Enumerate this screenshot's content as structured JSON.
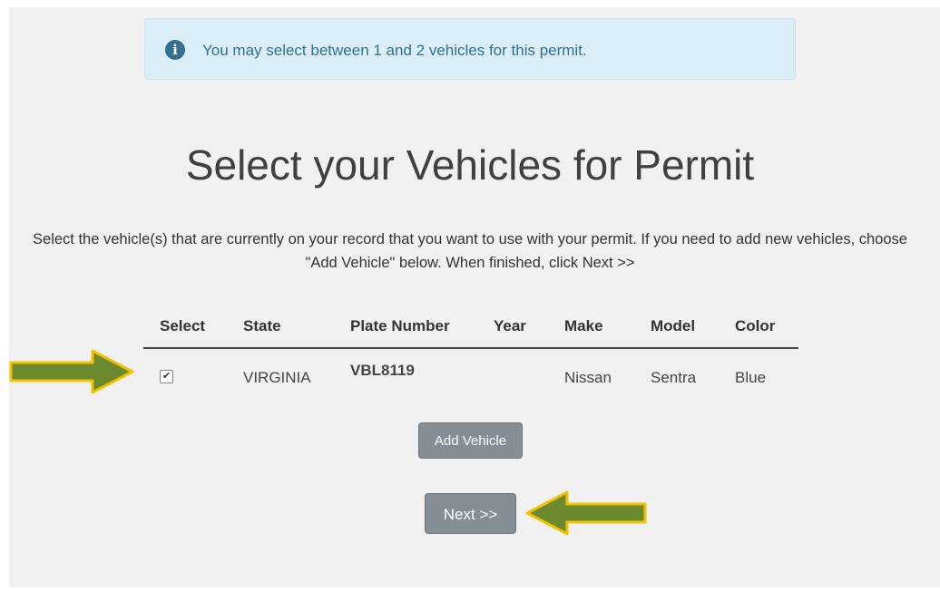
{
  "alert": {
    "icon": "info-icon",
    "text": "You may select between 1 and 2 vehicles for this permit."
  },
  "page_title": "Select your Vehicles for Permit",
  "intro": "Select the vehicle(s) that are currently on your record that you want to use with your permit. If you need to add new vehicles, choose \"Add Vehicle\" below. When finished, click Next >>",
  "table": {
    "headers": [
      "Select",
      "State",
      "Plate Number",
      "Year",
      "Make",
      "Model",
      "Color"
    ],
    "rows": [
      {
        "selected": true,
        "state": "VIRGINIA",
        "plate": "VBL8119",
        "year": "",
        "make": "Nissan",
        "model": "Sentra",
        "color": "Blue"
      }
    ]
  },
  "buttons": {
    "add_vehicle": "Add Vehicle",
    "next": "Next >>"
  },
  "annotations": {
    "arrow_color": "#6b8a2e",
    "arrow_outline": "#f2c200"
  }
}
